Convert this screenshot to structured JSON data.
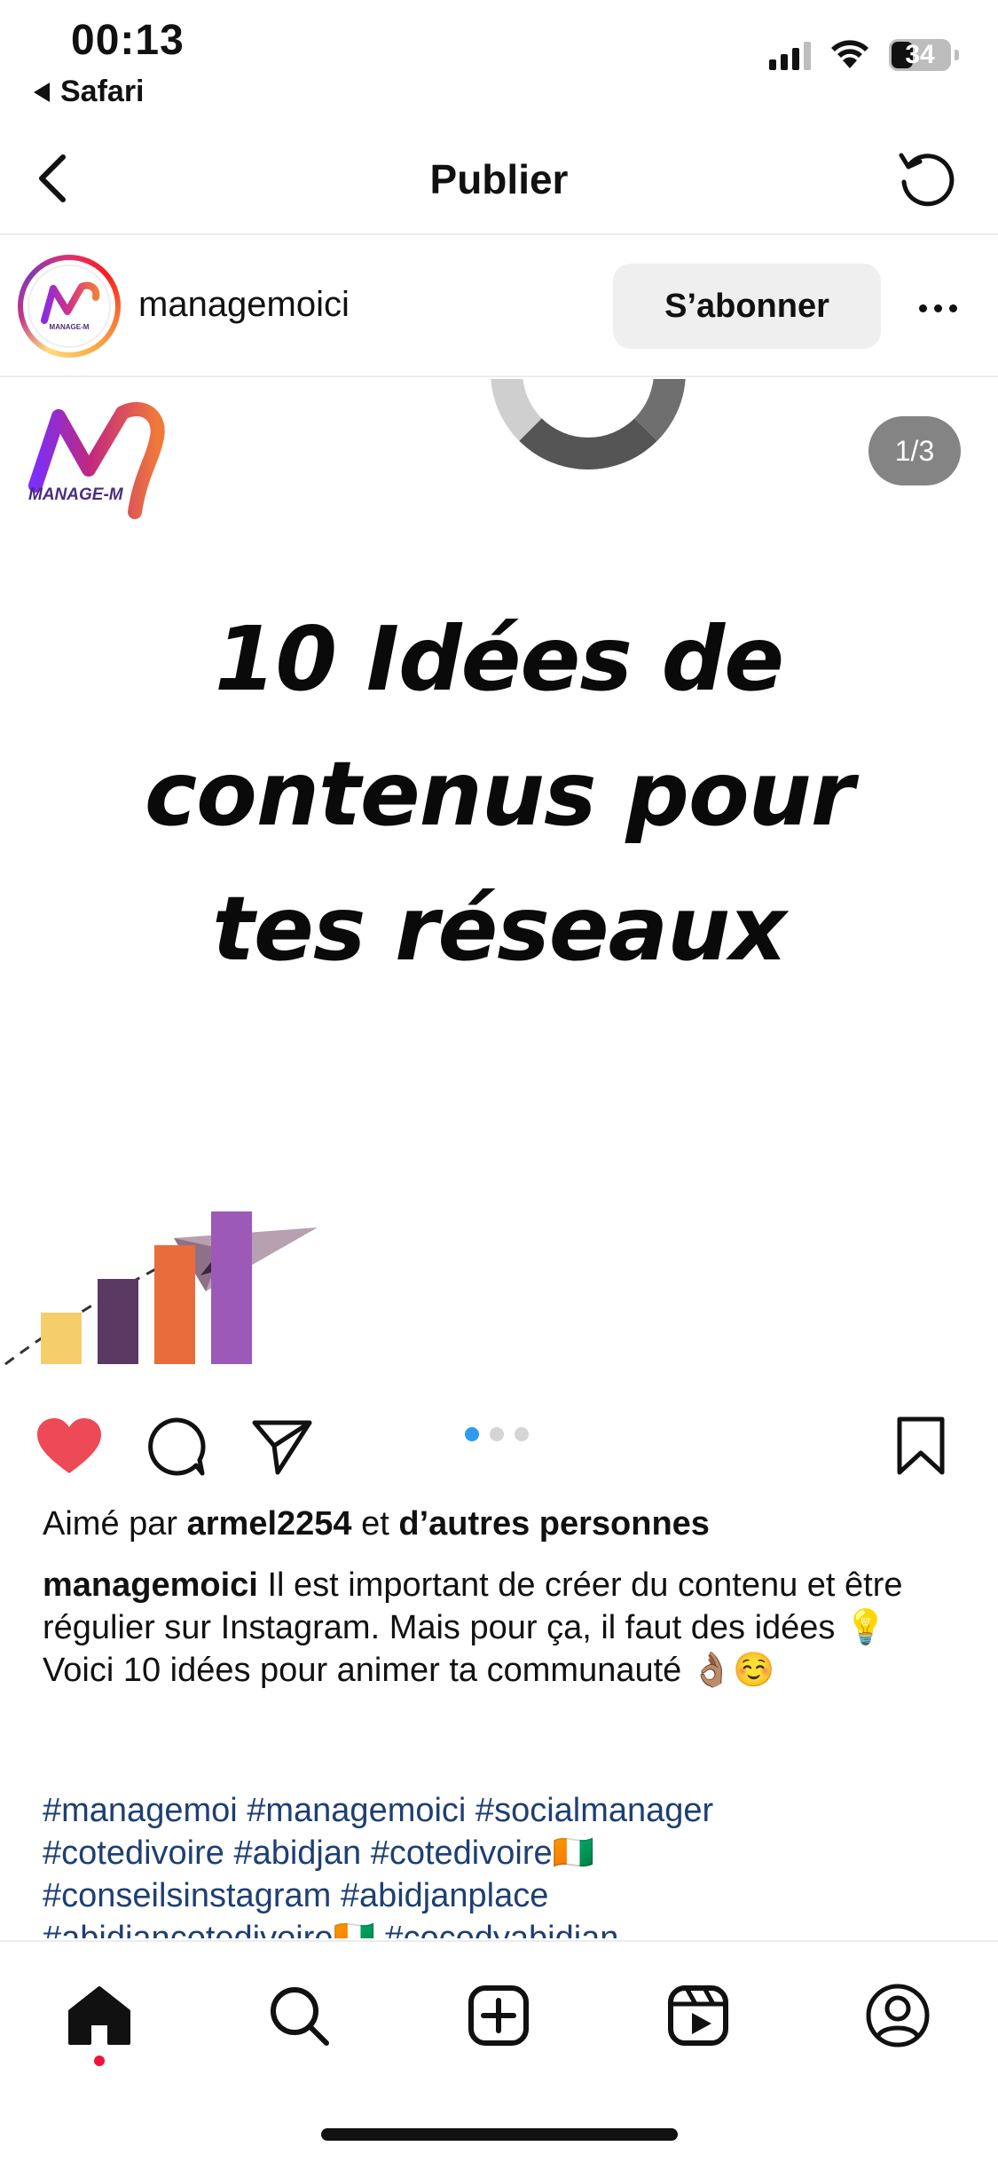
{
  "status_bar": {
    "time": "00:13",
    "back_app": "Safari",
    "battery": "34",
    "battery_level": 0.34
  },
  "nav": {
    "title": "Publier",
    "back_icon": "chevron-left-icon",
    "refresh_icon": "refresh-icon"
  },
  "post": {
    "username": "managemoici",
    "subscribe_label": "S’abonner",
    "counter": "1/3",
    "logo_text": "MANAGE-M",
    "headline": [
      "10 Idées de",
      "contenus pour",
      "tes réseaux"
    ],
    "active_slide": 1,
    "total_slides": 3
  },
  "art_bars": {
    "colors": [
      "#f5cd6b",
      "#5a3a63",
      "#e96c3d",
      "#9d59b8"
    ],
    "values": [
      1,
      2,
      3,
      4
    ]
  },
  "likes": {
    "prefix": "Aimé par",
    "user": "armel2254",
    "middle": "et",
    "suffix": "d’autres personnes"
  },
  "caption": {
    "username": "managemoici",
    "text_1": "Il est important de créer du contenu et être régulier sur Instagram. Mais pour ça, il faut des idées 💡",
    "text_2": "Voici 10 idées pour animer ta communauté 👌🏽☺️",
    "hashtags_1": "#managemoi #managemoici #socialmanager",
    "hashtags_2": "#cotedivoire #abidjan #cotedivoire🇨🇮",
    "hashtags_3": "#conseilsinstagram #abidjanplace",
    "hashtags_4": "#abidjancotedivoire🇨🇮 #cocodyabidjan"
  },
  "tabbar": {
    "items": [
      "home-icon",
      "search-icon",
      "create-icon",
      "reels-icon",
      "profile-icon"
    ]
  },
  "colors": {
    "like_red": "#ed4956",
    "hashtag_blue": "#1e3f73",
    "dot_active": "#2e9bf0",
    "notif_red": "#f0133d"
  }
}
